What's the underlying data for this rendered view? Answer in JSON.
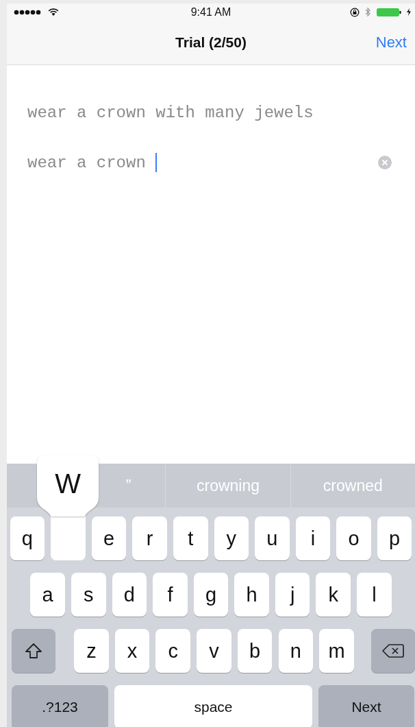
{
  "status_bar": {
    "time": "9:41 AM"
  },
  "nav": {
    "title": "Trial (2/50)",
    "action": "Next"
  },
  "prompt": "wear a crown with many jewels",
  "input": {
    "value": "wear a crown ",
    "focused": true
  },
  "suggestions": [
    {
      "text": "”"
    },
    {
      "text": "crowning"
    },
    {
      "text": "crowned"
    }
  ],
  "keyboard": {
    "rows": [
      {
        "keys": [
          {
            "kind": "letter",
            "label": "q",
            "pressed": false
          },
          {
            "kind": "letter",
            "label": "W",
            "pressed": true
          },
          {
            "kind": "letter",
            "label": "e",
            "pressed": false
          },
          {
            "kind": "letter",
            "label": "r",
            "pressed": false
          },
          {
            "kind": "letter",
            "label": "t",
            "pressed": false
          },
          {
            "kind": "letter",
            "label": "y",
            "pressed": false
          },
          {
            "kind": "letter",
            "label": "u",
            "pressed": false
          },
          {
            "kind": "letter",
            "label": "i",
            "pressed": false
          },
          {
            "kind": "letter",
            "label": "o",
            "pressed": false
          },
          {
            "kind": "letter",
            "label": "p",
            "pressed": false
          }
        ]
      },
      {
        "keys": [
          {
            "kind": "letter",
            "label": "a",
            "pressed": false
          },
          {
            "kind": "letter",
            "label": "s",
            "pressed": false
          },
          {
            "kind": "letter",
            "label": "d",
            "pressed": false
          },
          {
            "kind": "letter",
            "label": "f",
            "pressed": false
          },
          {
            "kind": "letter",
            "label": "g",
            "pressed": false
          },
          {
            "kind": "letter",
            "label": "h",
            "pressed": false
          },
          {
            "kind": "letter",
            "label": "j",
            "pressed": false
          },
          {
            "kind": "letter",
            "label": "k",
            "pressed": false
          },
          {
            "kind": "letter",
            "label": "l",
            "pressed": false
          }
        ]
      },
      {
        "keys": [
          {
            "kind": "shift"
          },
          {
            "kind": "letter",
            "label": "z",
            "pressed": false
          },
          {
            "kind": "letter",
            "label": "x",
            "pressed": false
          },
          {
            "kind": "letter",
            "label": "c",
            "pressed": false
          },
          {
            "kind": "letter",
            "label": "v",
            "pressed": false
          },
          {
            "kind": "letter",
            "label": "b",
            "pressed": false
          },
          {
            "kind": "letter",
            "label": "n",
            "pressed": false
          },
          {
            "kind": "letter",
            "label": "m",
            "pressed": false
          },
          {
            "kind": "delete"
          }
        ]
      },
      {
        "keys": [
          {
            "kind": "mode",
            "label": ".?123"
          },
          {
            "kind": "space",
            "label": "space"
          },
          {
            "kind": "return",
            "label": "Next"
          }
        ]
      }
    ]
  }
}
